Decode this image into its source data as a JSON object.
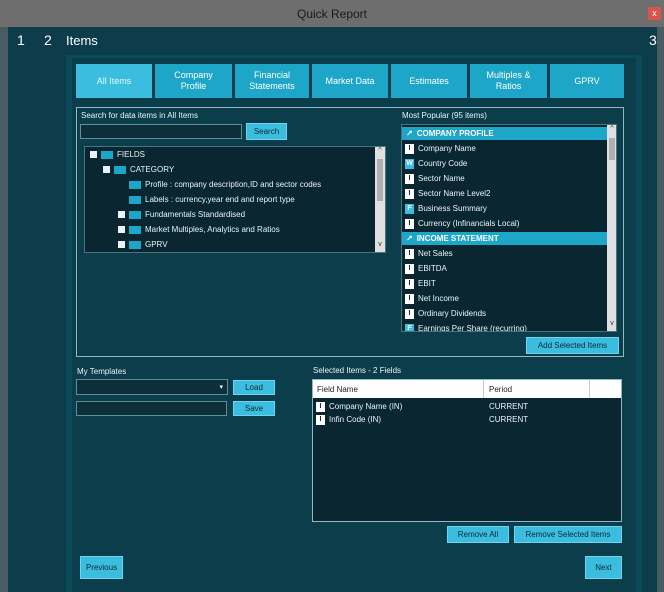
{
  "window": {
    "title": "Quick Report",
    "close_label": "x"
  },
  "steps": {
    "step1": "1",
    "step2": "2",
    "step3": "3",
    "title": "Items"
  },
  "tabs": [
    {
      "label": "All Items",
      "active": true
    },
    {
      "label": "Company\nProfile",
      "active": false
    },
    {
      "label": "Financial\nStatements",
      "active": false
    },
    {
      "label": "Market Data",
      "active": false
    },
    {
      "label": "Estimates",
      "active": false
    },
    {
      "label": "Multiples &\nRatios",
      "active": false
    },
    {
      "label": "GPRV",
      "active": false
    }
  ],
  "search": {
    "label": "Search for data items  in All Items",
    "value": "",
    "button": "Search"
  },
  "tree": {
    "root": "FIELDS",
    "category": "CATEGORY",
    "items": [
      "Profile : company description,ID and sector codes",
      "Labels : currency,year end and report type",
      "Fundamentals Standardised",
      "Market Multiples, Analytics and Ratios",
      "GPRV"
    ]
  },
  "popular": {
    "label": "Most Popular (95 items)",
    "rows": [
      {
        "type": "header",
        "text": "COMPANY PROFILE"
      },
      {
        "badge": "I",
        "text": "Company Name"
      },
      {
        "badge": "W",
        "text": "Country Code",
        "blue": true
      },
      {
        "badge": "I",
        "text": "Sector Name"
      },
      {
        "badge": "I",
        "text": "Sector Name Level2"
      },
      {
        "badge": "F",
        "text": "Business Summary",
        "blue": true
      },
      {
        "badge": "I",
        "text": "Currency (Infinancials Local)"
      },
      {
        "type": "header",
        "text": "INCOME STATEMENT"
      },
      {
        "badge": "I",
        "text": "Net Sales"
      },
      {
        "badge": "I",
        "text": "EBITDA"
      },
      {
        "badge": "I",
        "text": "EBIT"
      },
      {
        "badge": "I",
        "text": "Net Income"
      },
      {
        "badge": "I",
        "text": "Ordinary Dividends"
      },
      {
        "badge": "F",
        "text": "Earnings Per Share (recurring)",
        "blue": true
      }
    ],
    "add_button": "Add Selected Items"
  },
  "templates": {
    "label": "My Templates",
    "select_value": "",
    "load_button": "Load",
    "name_value": "",
    "save_button": "Save"
  },
  "selected": {
    "label": "Selected Items - 2 Fields",
    "columns": [
      "Field Name",
      "Period"
    ],
    "rows": [
      {
        "field": "Company Name (IN)",
        "period": "CURRENT"
      },
      {
        "field": "Infin Code (IN)",
        "period": "CURRENT"
      }
    ],
    "remove_all": "Remove All",
    "remove_selected": "Remove Selected Items"
  },
  "nav": {
    "previous": "Previous",
    "next": "Next"
  }
}
